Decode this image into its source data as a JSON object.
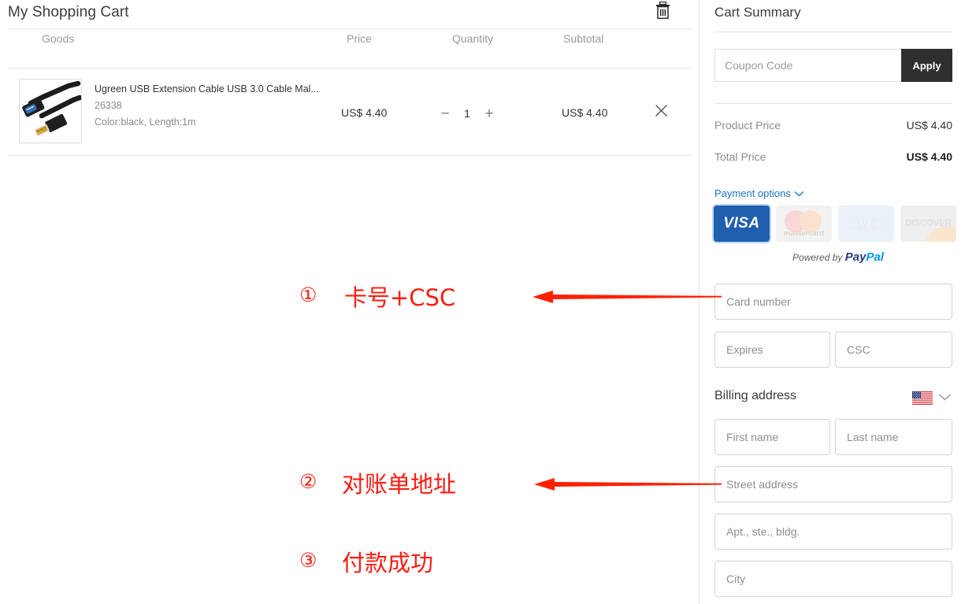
{
  "cart": {
    "title": "My Shopping Cart",
    "delete_icon": "trash-icon",
    "columns": {
      "goods": "Goods",
      "price": "Price",
      "quantity": "Quantity",
      "subtotal": "Subtotal"
    },
    "items": [
      {
        "name": "Ugreen USB Extension Cable USB 3.0 Cable Mal...",
        "sku": "26338",
        "attributes": "Color:black, Length:1m",
        "price": "US$ 4.40",
        "quantity": "1",
        "subtotal": "US$ 4.40",
        "decrease_label": "−",
        "increase_label": "+",
        "remove_icon": "close-icon"
      }
    ]
  },
  "summary": {
    "title": "Cart Summary",
    "coupon": {
      "placeholder": "Coupon Code",
      "value": "",
      "apply_label": "Apply"
    },
    "product_price_label": "Product Price",
    "product_price_value": "US$ 4.40",
    "total_price_label": "Total Price",
    "total_price_value": "US$ 4.40",
    "payment_options_label": "Payment options",
    "payment_options_chevron": "chevron-down-icon",
    "cards": [
      {
        "name": "VISA",
        "id": "visa",
        "selected": true
      },
      {
        "name": "mastercard",
        "id": "mastercard",
        "selected": false
      },
      {
        "name": "AMEX",
        "id": "amex",
        "selected": false
      },
      {
        "name": "DISCOVER",
        "id": "discover",
        "selected": false
      }
    ],
    "powered_by": "Powered by",
    "paypal_pay": "Pay",
    "paypal_pal": "Pal",
    "card_number_placeholder": "Card number",
    "expires_placeholder": "Expires",
    "csc_placeholder": "CSC",
    "billing_title": "Billing address",
    "country_flag": "us-flag-icon",
    "country_chevron": "chevron-down-icon",
    "first_name_placeholder": "First name",
    "last_name_placeholder": "Last name",
    "street_placeholder": "Street address",
    "apt_placeholder": "Apt., ste., bldg.",
    "city_placeholder": "City"
  },
  "annotations": {
    "accent_color": "#ff1a10",
    "items": [
      {
        "number": "①",
        "text": "卡号+CSC"
      },
      {
        "number": "②",
        "text": "对账单地址"
      },
      {
        "number": "③",
        "text": "付款成功"
      }
    ]
  }
}
